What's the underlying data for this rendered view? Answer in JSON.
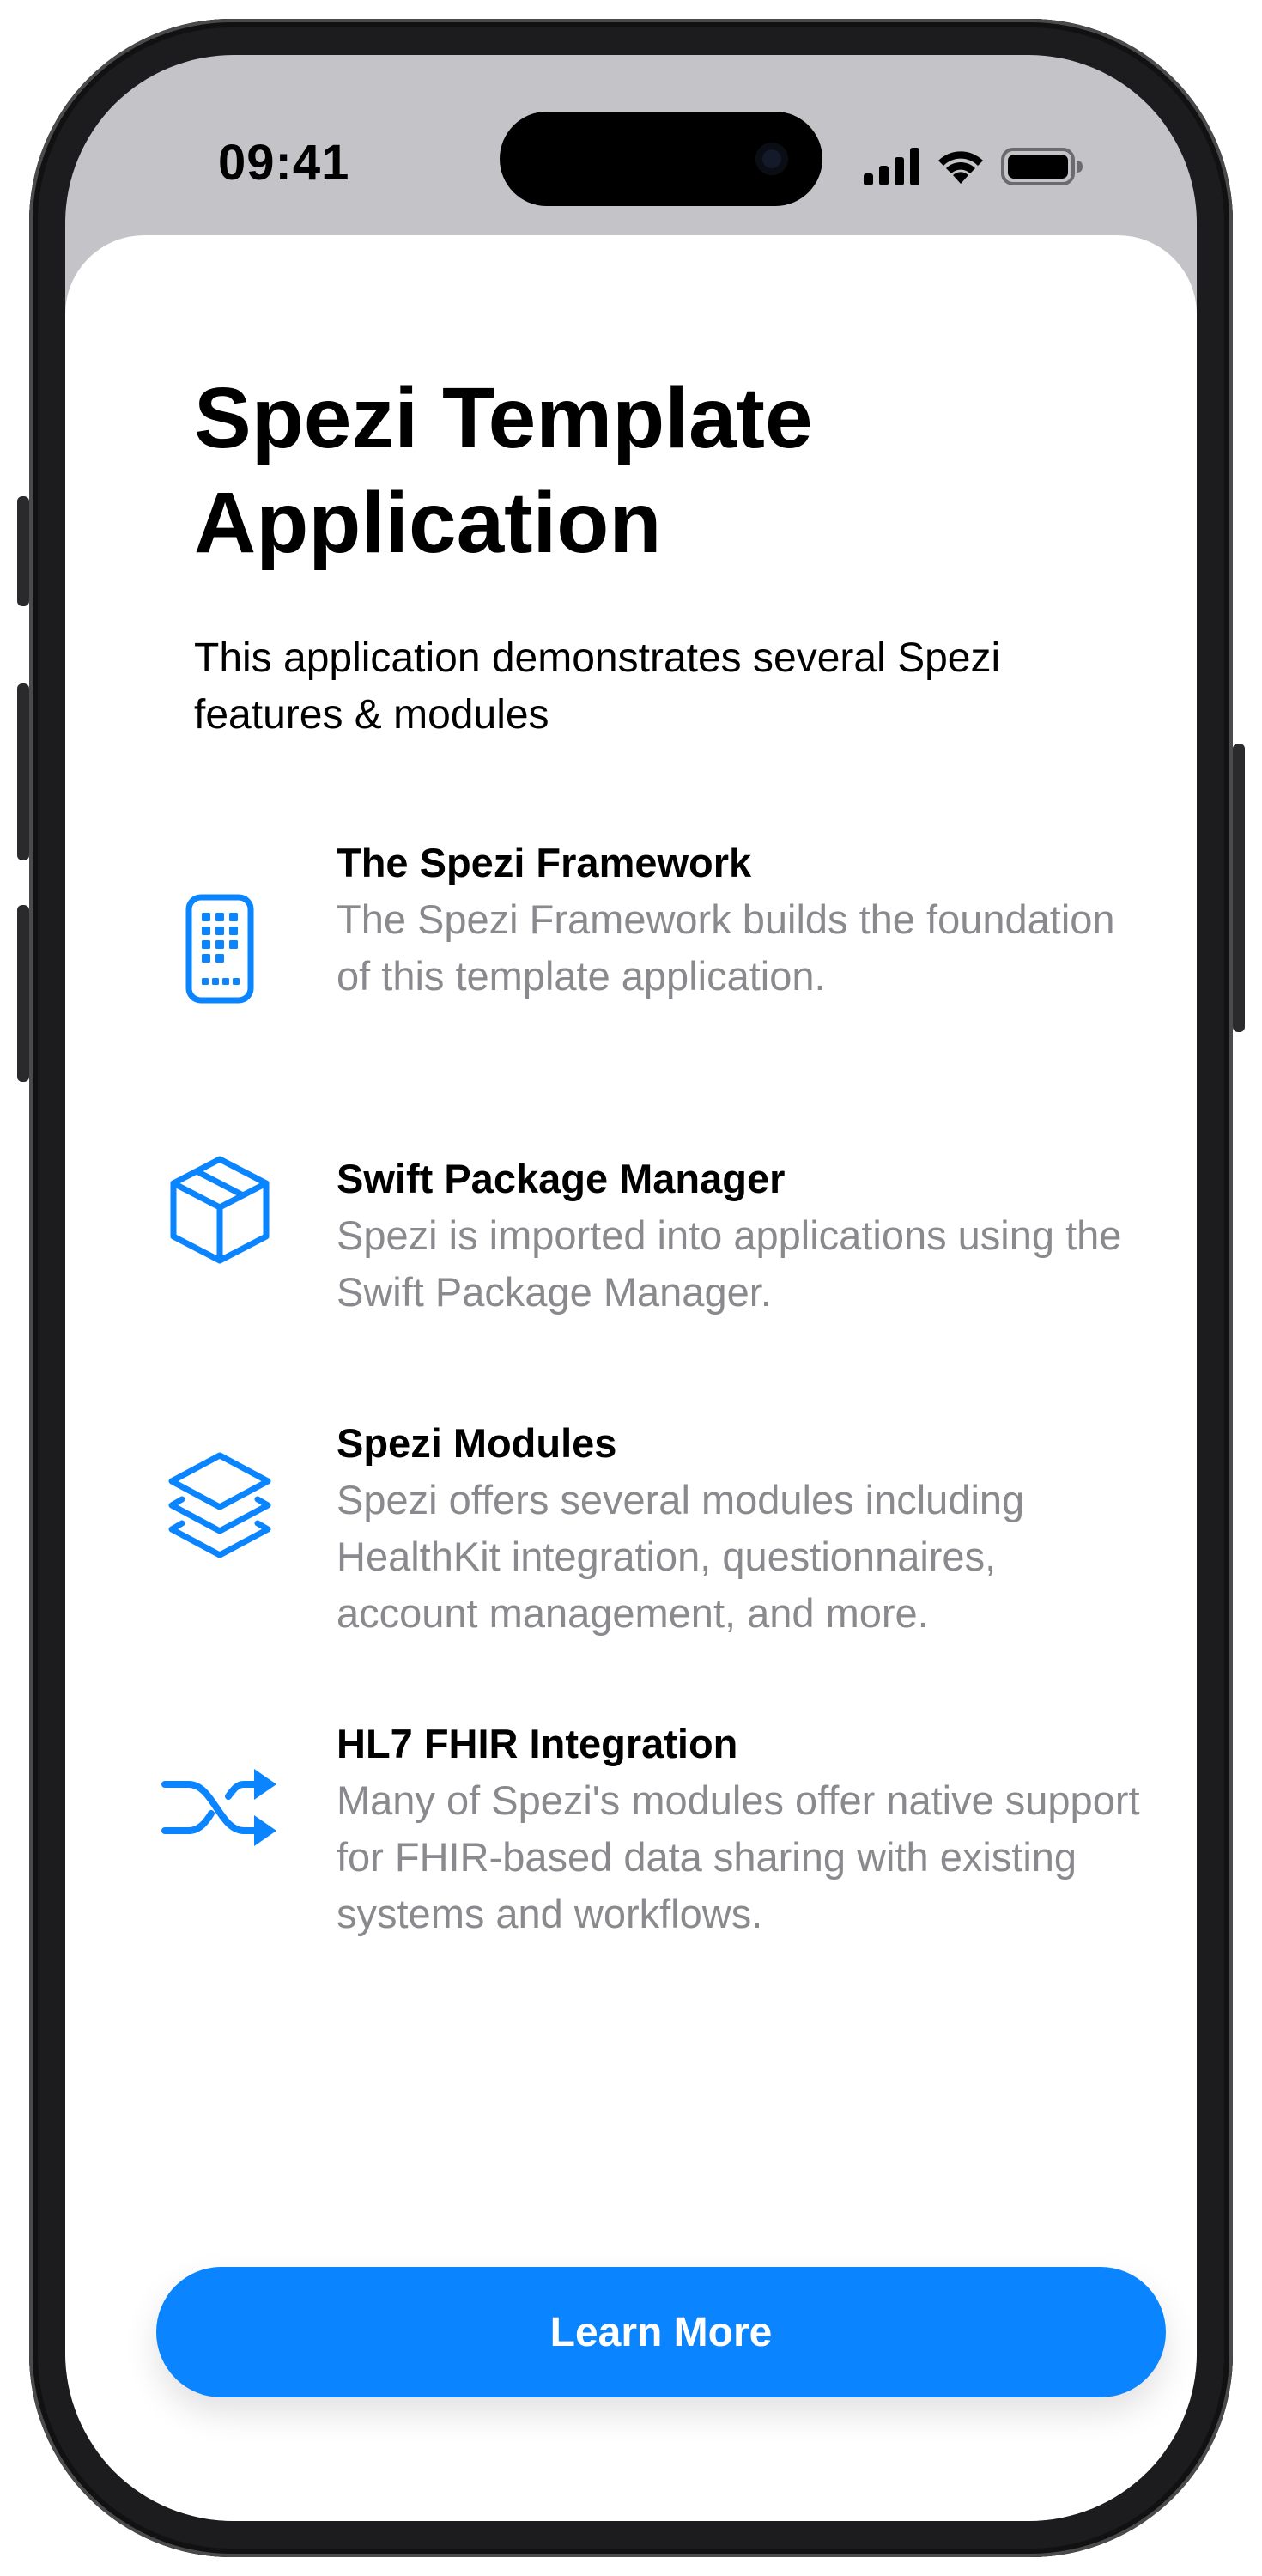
{
  "status_bar": {
    "time": "09:41",
    "icons": [
      "cellular-signal-icon",
      "wifi-icon",
      "battery-icon"
    ]
  },
  "onboarding": {
    "title": "Spezi Template Application",
    "subtitle": "This application demonstrates several Spezi features & modules",
    "features": [
      {
        "icon": "apps-iphone-icon",
        "title": "The Spezi Framework",
        "description": "The Spezi Framework builds the foundation of this template application."
      },
      {
        "icon": "shippingbox-icon",
        "title": "Swift Package Manager",
        "description": "Spezi is imported into applications using the Swift Package Manager."
      },
      {
        "icon": "stacked-layers-icon",
        "title": "Spezi Modules",
        "description": "Spezi offers several modules including HealthKit integration, questionnaires, account management, and more."
      },
      {
        "icon": "shuffle-icon",
        "title": "HL7 FHIR Integration",
        "description": "Many of Spezi's modules offer native support for FHIR-based data sharing with existing systems and workflows."
      }
    ],
    "button_label": "Learn More"
  },
  "colors": {
    "accent": "#0A84FF",
    "description_text": "#8A8A8E",
    "status_bar_background": "#C4C3C8"
  }
}
